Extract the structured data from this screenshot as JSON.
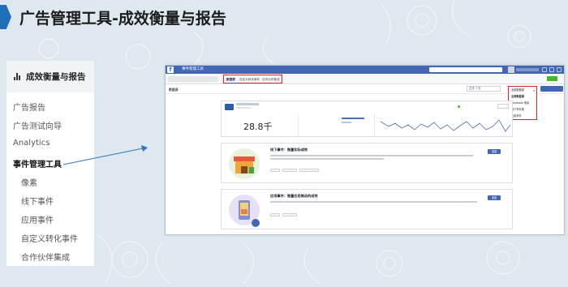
{
  "page": {
    "title": "广告管理工具-成效衡量与报告"
  },
  "left_menu": {
    "header": "成效衡量与报告",
    "items": [
      {
        "label": "广告报告",
        "bold": false
      },
      {
        "label": "广告测试向导",
        "bold": false
      },
      {
        "label": "Analytics",
        "bold": false
      },
      {
        "label": "事件管理工具",
        "bold": true
      },
      {
        "label": "像素",
        "bold": false
      },
      {
        "label": "线下事件",
        "bold": false
      },
      {
        "label": "应用事件",
        "bold": false
      },
      {
        "label": "自定义转化事件",
        "bold": false
      },
      {
        "label": "合作伙伴集成",
        "bold": false
      }
    ]
  },
  "screenshot": {
    "app_title": "事件管理工具",
    "tabs": [
      "数据源",
      "自定义转化事件",
      "合作伙伴集成"
    ],
    "subbar_title": "数据源",
    "date_range": "过去 7 天",
    "dropdown": {
      "items": [
        "全部数据源",
        "全部数据源",
        "Facebook 像素",
        "线下事件集",
        "应用事件"
      ]
    },
    "pixel_card": {
      "stat_big_value": "28.8千"
    },
    "offline_card": {
      "title": "线下事件：衡量实际成效",
      "connect_label": "连接"
    },
    "app_card": {
      "title": "应用事件：衡量应用推动的成效",
      "connect_label": "连接"
    }
  },
  "colors": {
    "accent": "#1e6fb8",
    "facebook_blue": "#4267b2",
    "highlight_red": "#e0202a"
  }
}
